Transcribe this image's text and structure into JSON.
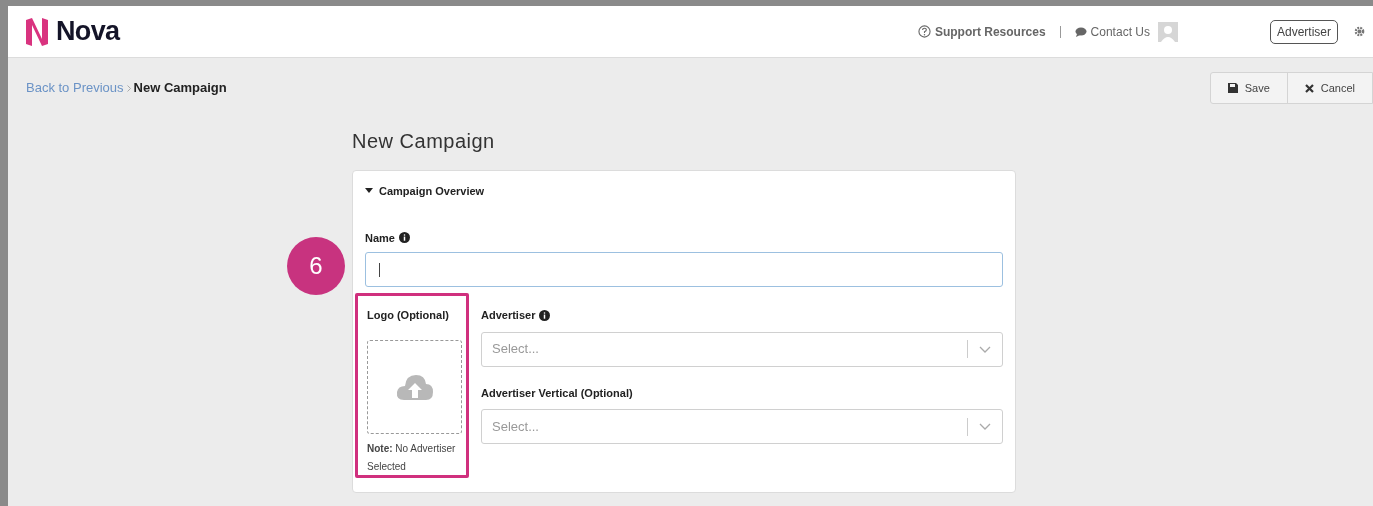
{
  "header": {
    "logo_text": "Nova",
    "support": "Support Resources",
    "contact": "Contact Us",
    "role_button": "Advertiser"
  },
  "breadcrumb": {
    "back_link": "Back to Previous",
    "current": "New Campaign"
  },
  "toolbar": {
    "buttons": [
      {
        "kind": "save",
        "label": "Save"
      },
      {
        "kind": "cancel",
        "label": "Cancel"
      }
    ]
  },
  "page_title": "New Campaign",
  "section": {
    "title": "Campaign Overview",
    "expanded": true,
    "name_field": {
      "label": "Name",
      "focused": true
    },
    "logo": {
      "label": "Logo (Optional)",
      "note": "**Note:** No Advertiser Selected"
    },
    "selects": [
      {
        "label": "Advertiser",
        "info": true,
        "placeholder": "Select..."
      },
      {
        "label": "Advertiser Vertical (Optional)",
        "info": false,
        "placeholder": "Select..."
      }
    ]
  },
  "annotation": {
    "step": "6"
  }
}
